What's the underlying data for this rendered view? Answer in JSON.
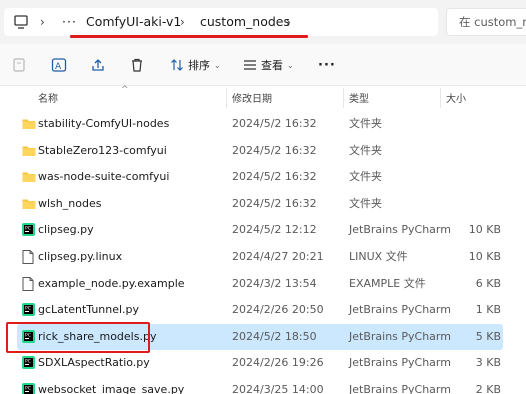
{
  "address_bar": {
    "more_label": "···",
    "crumbs": [
      "ComfyUI-aki-v1",
      "custom_nodes"
    ],
    "search_placeholder": "在 custom_nodes 中搜索"
  },
  "toolbar": {
    "sort_label": "排序",
    "view_label": "查看",
    "more_label": "···"
  },
  "columns": {
    "name": "名称",
    "date": "修改日期",
    "type": "类型",
    "size": "大小"
  },
  "files": [
    {
      "name": "stability-ComfyUI-nodes",
      "date": "2024/5/2 16:32",
      "type": "文件夹",
      "size": "",
      "icon": "folder-icon"
    },
    {
      "name": "StableZero123-comfyui",
      "date": "2024/5/2 16:32",
      "type": "文件夹",
      "size": "",
      "icon": "folder-icon"
    },
    {
      "name": "was-node-suite-comfyui",
      "date": "2024/5/2 16:32",
      "type": "文件夹",
      "size": "",
      "icon": "folder-icon"
    },
    {
      "name": "wlsh_nodes",
      "date": "2024/5/2 16:32",
      "type": "文件夹",
      "size": "",
      "icon": "folder-icon"
    },
    {
      "name": "clipseg.py",
      "date": "2024/5/2 12:12",
      "type": "JetBrains PyCharm",
      "size": "10 KB",
      "icon": "pycharm-file-icon"
    },
    {
      "name": "clipseg.py.linux",
      "date": "2024/4/27 20:21",
      "type": "LINUX 文件",
      "size": "10 KB",
      "icon": "document-icon"
    },
    {
      "name": "example_node.py.example",
      "date": "2024/3/2 13:54",
      "type": "EXAMPLE 文件",
      "size": "6 KB",
      "icon": "document-icon"
    },
    {
      "name": "gcLatentTunnel.py",
      "date": "2024/2/26 20:50",
      "type": "JetBrains PyCharm",
      "size": "1 KB",
      "icon": "pycharm-file-icon"
    },
    {
      "name": "rick_share_models.py",
      "date": "2024/5/2 18:50",
      "type": "JetBrains PyCharm",
      "size": "5 KB",
      "icon": "pycharm-file-icon",
      "selected": true
    },
    {
      "name": "SDXLAspectRatio.py",
      "date": "2024/2/26 19:26",
      "type": "JetBrains PyCharm",
      "size": "3 KB",
      "icon": "pycharm-file-icon"
    },
    {
      "name": "websocket_image_save.py",
      "date": "2024/3/25 14:00",
      "type": "JetBrains PyCharm",
      "size": "2 KB",
      "icon": "pycharm-file-icon"
    }
  ],
  "colors": {
    "selection": "#cce8ff",
    "annotation_red": "#e01b1b",
    "folder": "#f4c542"
  }
}
